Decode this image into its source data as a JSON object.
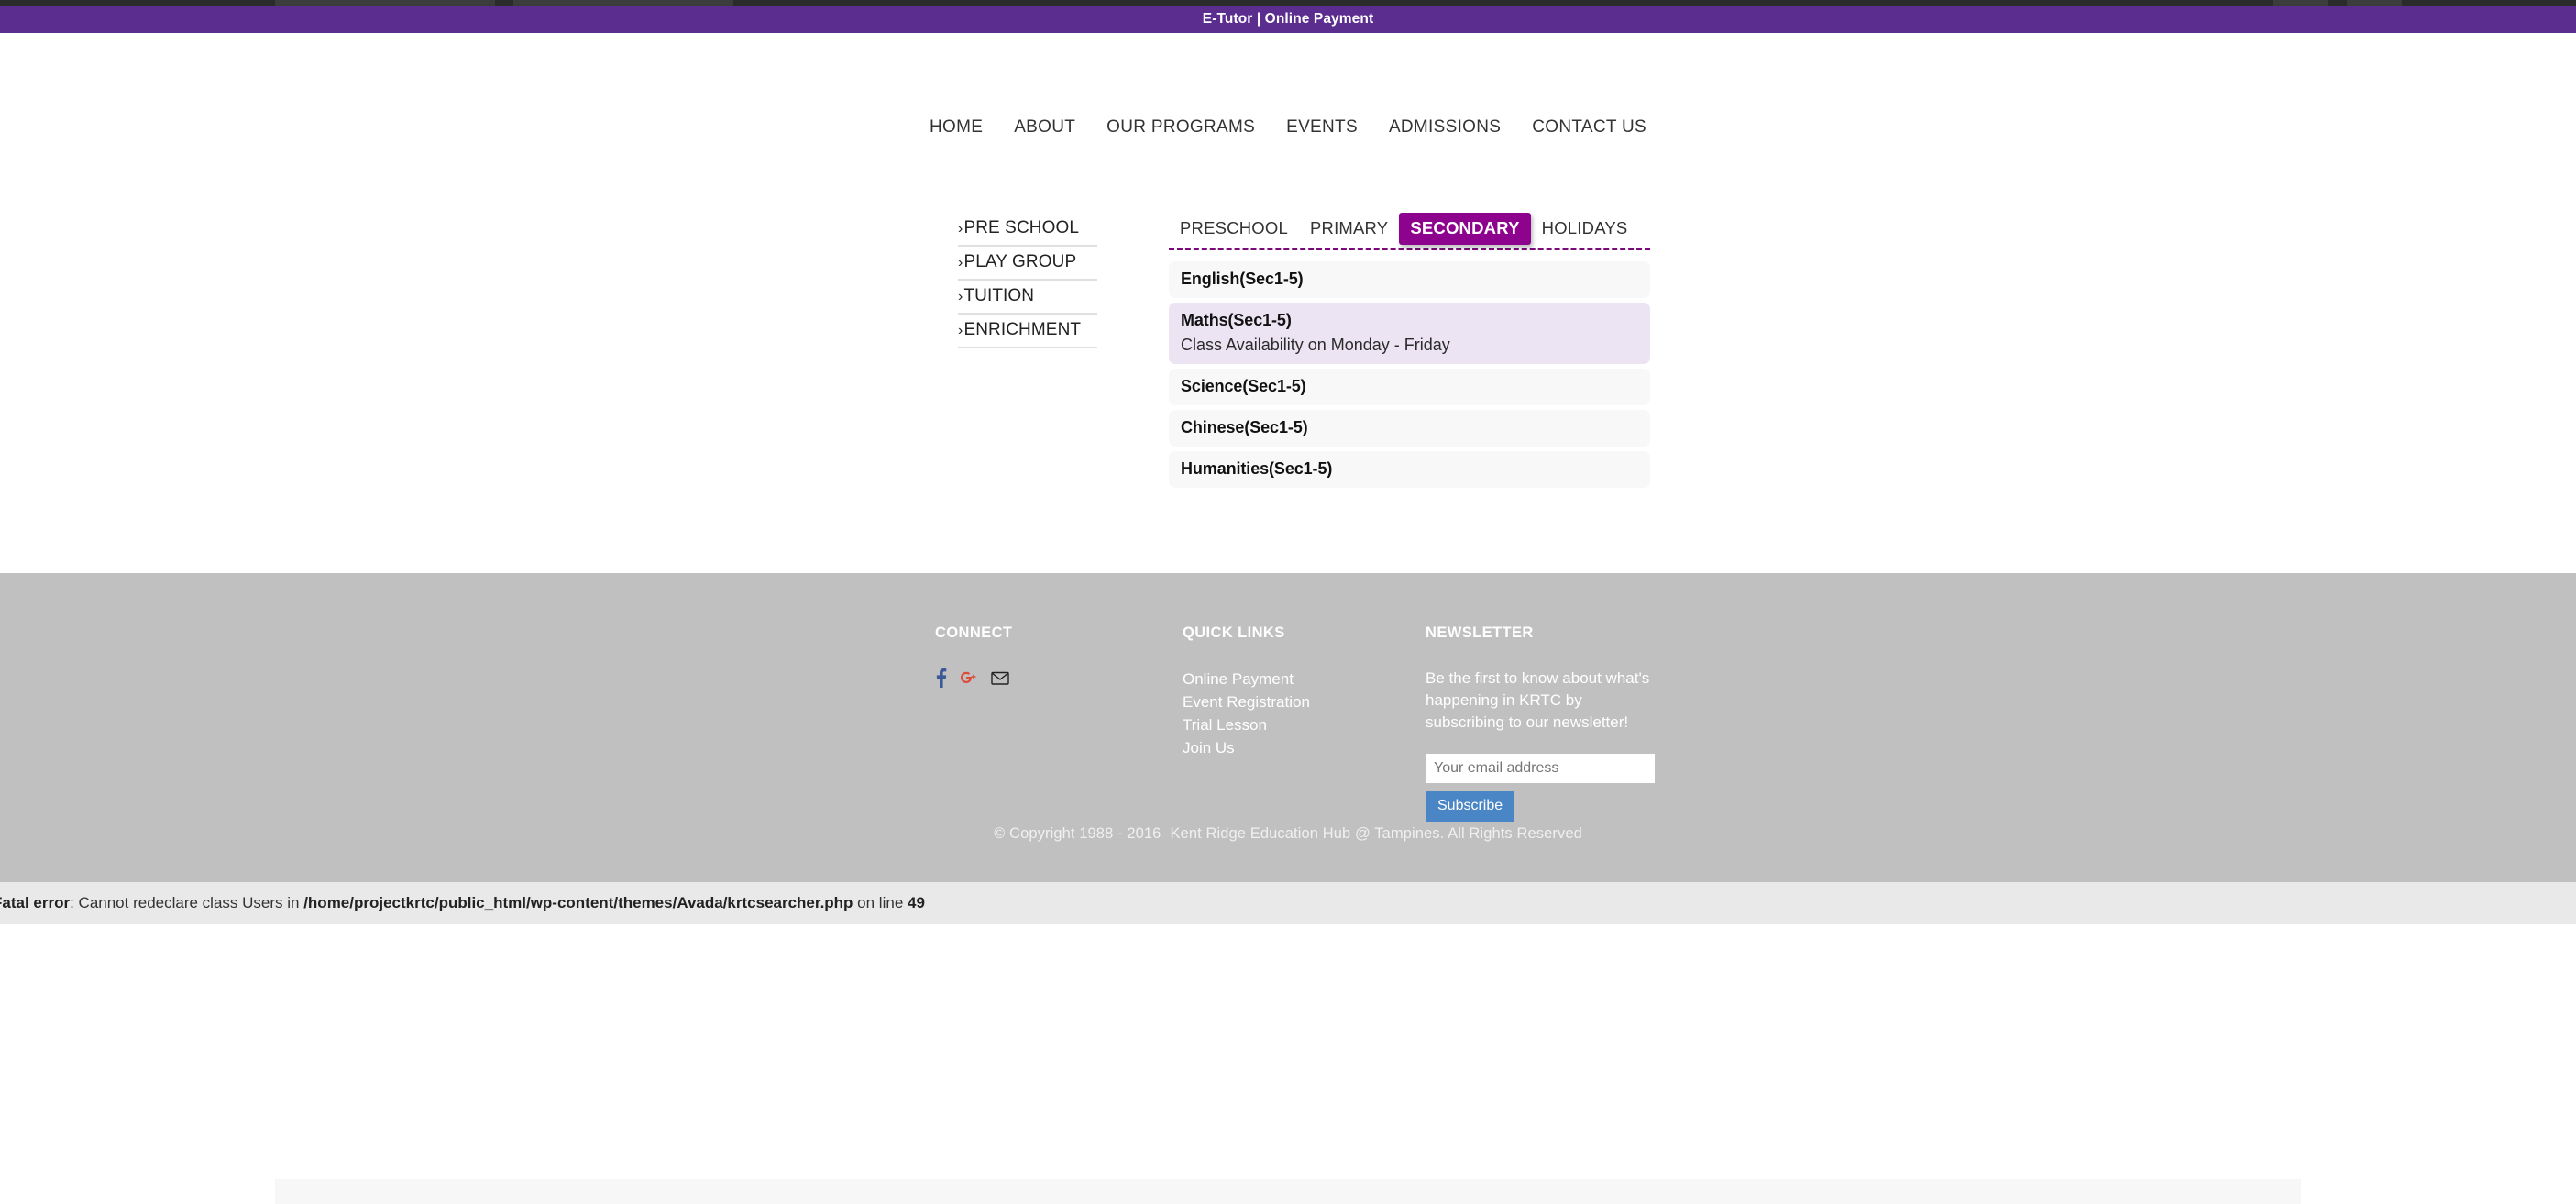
{
  "topbar": {
    "link_label": "E-Tutor | Online Payment"
  },
  "mainnav": {
    "items": [
      {
        "label": "HOME"
      },
      {
        "label": "ABOUT"
      },
      {
        "label": "OUR PROGRAMS"
      },
      {
        "label": "EVENTS"
      },
      {
        "label": "ADMISSIONS"
      },
      {
        "label": "CONTACT US"
      }
    ]
  },
  "sidemenu": {
    "chevron": "›",
    "items": [
      {
        "label": "PRE SCHOOL"
      },
      {
        "label": "PLAY GROUP"
      },
      {
        "label": "TUITION"
      },
      {
        "label": "ENRICHMENT"
      }
    ]
  },
  "program_tabs": {
    "tabs": [
      {
        "label": "PRESCHOOL",
        "active": false
      },
      {
        "label": "PRIMARY",
        "active": false
      },
      {
        "label": "SECONDARY",
        "active": true
      },
      {
        "label": "HOLIDAYS",
        "active": false
      }
    ],
    "active_tab": "SECONDARY",
    "accent_color": "#8d038d",
    "divider_color": "#7a0a7a"
  },
  "accordion": {
    "rows": [
      {
        "title": "English(Sec1-5)",
        "body": "",
        "open": false
      },
      {
        "title": "Maths(Sec1-5)",
        "body": "Class Availability on Monday - Friday",
        "open": true
      },
      {
        "title": "Science(Sec1-5)",
        "body": "",
        "open": false
      },
      {
        "title": "Chinese(Sec1-5)",
        "body": "",
        "open": false
      },
      {
        "title": "Humanities(Sec1-5)",
        "body": "",
        "open": false
      }
    ]
  },
  "footer": {
    "connect": {
      "heading": "CONNECT",
      "socials": [
        {
          "name": "facebook-icon",
          "color": "#3b5998"
        },
        {
          "name": "google-plus-icon",
          "color": "#dd4b39"
        },
        {
          "name": "email-icon",
          "color": "#222222"
        }
      ]
    },
    "quick_links": {
      "heading": "QUICK LINKS",
      "items": [
        {
          "label": "Online Payment"
        },
        {
          "label": "Event Registration"
        },
        {
          "label": "Trial Lesson"
        },
        {
          "label": "Join Us"
        }
      ]
    },
    "newsletter": {
      "heading": "NEWSLETTER",
      "description": "Be the first to know about what's happening in KRTC by subscribing to our newsletter!",
      "email_placeholder": "Your email address",
      "email_value": "",
      "subscribe_label": "Subscribe",
      "button_color": "#4a86c5"
    },
    "copyright_left": "© Copyright 1988 - 2016",
    "copyright_right": "Kent Ridge Education Hub @ Tampines.  All Rights Reserved",
    "background_color": "#c0c0c0"
  },
  "php_error": {
    "label": "Fatal error",
    "message": ": Cannot redeclare class Users in ",
    "path": "/home/projectkrtc/public_html/wp-content/themes/Avada/krtcsearcher.php",
    "line_prefix": " on line ",
    "line_number": "49"
  }
}
